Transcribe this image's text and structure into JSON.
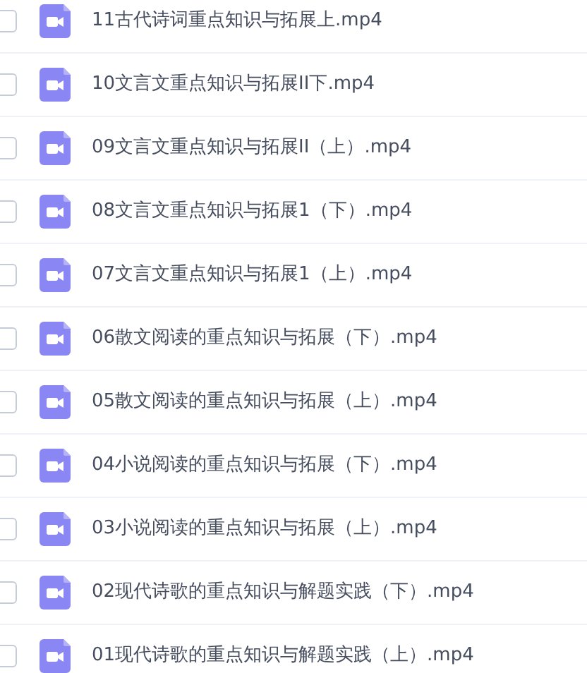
{
  "files": [
    {
      "name": "11古代诗词重点知识与拓展上.mp4",
      "checked": false
    },
    {
      "name": "10文言文重点知识与拓展II下.mp4",
      "checked": false
    },
    {
      "name": "09文言文重点知识与拓展II（上）.mp4",
      "checked": false
    },
    {
      "name": "08文言文重点知识与拓展1（下）.mp4",
      "checked": false
    },
    {
      "name": "07文言文重点知识与拓展1（上）.mp4",
      "checked": false
    },
    {
      "name": "06散文阅读的重点知识与拓展（下）.mp4",
      "checked": false
    },
    {
      "name": "05散文阅读的重点知识与拓展（上）.mp4",
      "checked": false
    },
    {
      "name": "04小说阅读的重点知识与拓展（下）.mp4",
      "checked": false
    },
    {
      "name": "03小说阅读的重点知识与拓展（上）.mp4",
      "checked": false
    },
    {
      "name": "02现代诗歌的重点知识与解题实践（下）.mp4",
      "checked": false
    },
    {
      "name": "01现代诗歌的重点知识与解题实践（上）.mp4",
      "checked": false
    }
  ]
}
